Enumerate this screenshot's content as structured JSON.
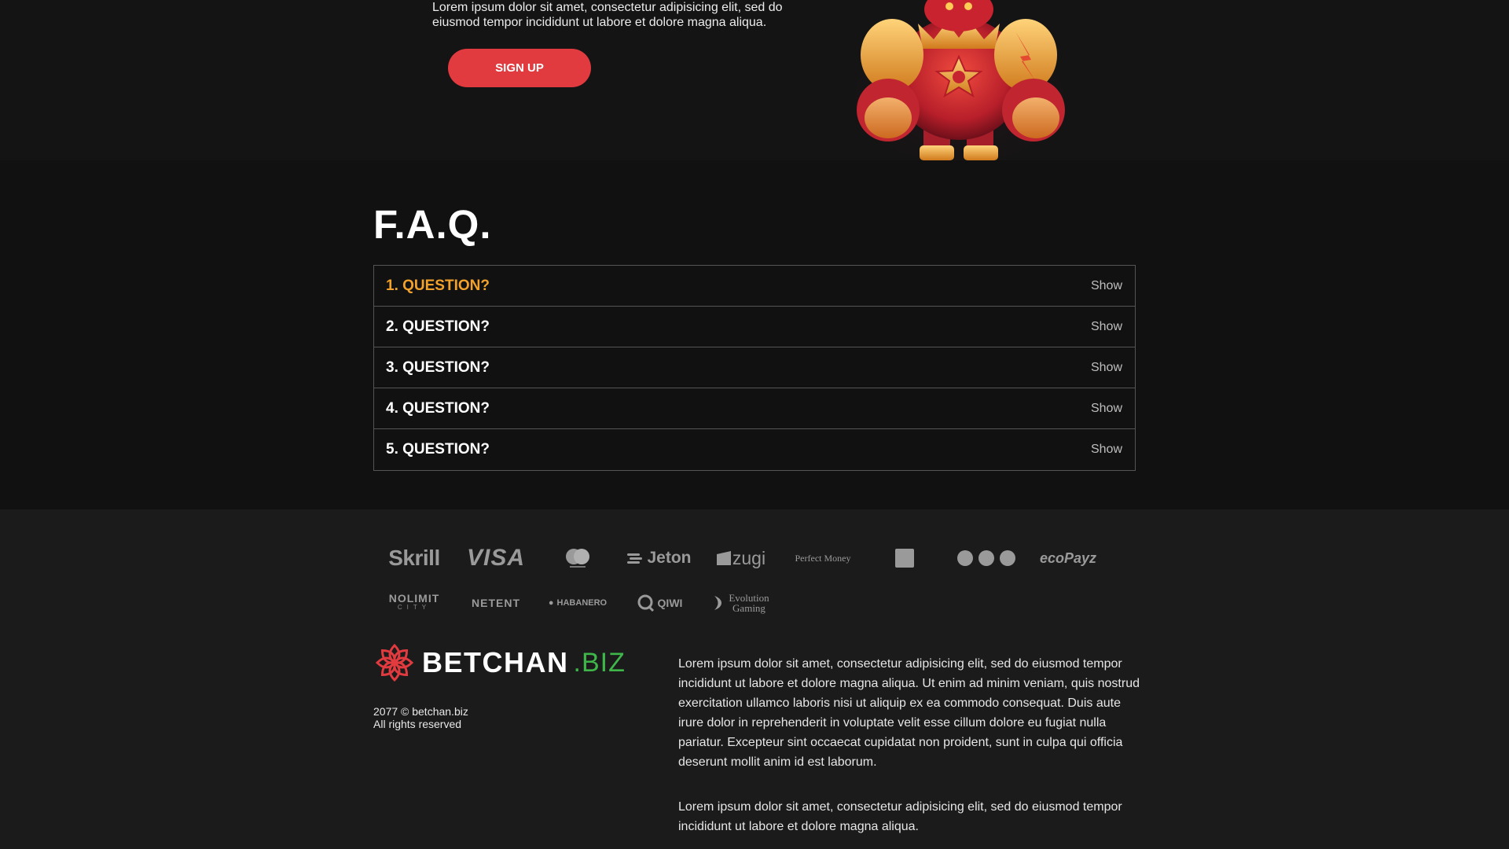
{
  "hero": {
    "text": "Lorem ipsum dolor sit amet, consectetur adipisicing elit, sed do eiusmod tempor incididunt ut labore et dolore magna aliqua.",
    "signup_label": "SIGN UP"
  },
  "faq": {
    "title": "F.A.Q.",
    "items": [
      {
        "question": "1. QUESTION?",
        "toggle": "Show",
        "active": true
      },
      {
        "question": "2. QUESTION?",
        "toggle": "Show",
        "active": false
      },
      {
        "question": "3. QUESTION?",
        "toggle": "Show",
        "active": false
      },
      {
        "question": "4. QUESTION?",
        "toggle": "Show",
        "active": false
      },
      {
        "question": "5. QUESTION?",
        "toggle": "Show",
        "active": false
      }
    ]
  },
  "payments": {
    "row1": [
      "Skrill",
      "VISA",
      "mastercard",
      "Jeton",
      "zugi",
      "Perfect Money",
      "square-logo",
      "three-dots-logo",
      "ecoPayz"
    ],
    "row1_text": {
      "skrill": "Skrill",
      "visa": "VISA",
      "jeton": "Jeton",
      "zugi": "zugi",
      "perfect_money": "Perfect Money",
      "ecopayz": "ecoPayz"
    },
    "row2_text": {
      "nolimit": "NOLIMIT",
      "nolimit_sub": "CITY",
      "netent": "NETENT",
      "habanero": "HABANERO",
      "qiwi": "QIWI",
      "evolution": "Evolution",
      "evolution_sub": "Gaming"
    }
  },
  "footer": {
    "brand_name": "BETCHAN",
    "brand_tld": ".BIZ",
    "copyright_line1": "2077 © betchan.biz",
    "copyright_line2": "All rights reserved",
    "paragraph1": "Lorem ipsum dolor sit amet, consectetur adipisicing elit, sed do eiusmod tempor incididunt ut labore et dolore magna aliqua. Ut enim ad minim veniam, quis nostrud exercitation ullamco laboris nisi ut aliquip ex ea commodo consequat. Duis aute irure dolor in reprehenderit in voluptate velit esse cillum dolore eu fugiat nulla pariatur. Excepteur sint occaecat cupidatat non proident, sunt in culpa qui officia deserunt mollit anim id est laborum.",
    "paragraph2": "Lorem ipsum dolor sit amet, consectetur adipisicing elit, sed do eiusmod tempor incididunt ut labore et dolore magna aliqua."
  },
  "colors": {
    "accent_red": "#e13a3f",
    "active_question": "#f2a22b",
    "brand_green": "#3fb64a"
  },
  "icons": [
    "robot-character-image",
    "mastercard-icon",
    "flower-logo-icon",
    "square-logo-icon",
    "three-dots-icon",
    "habanero-icon",
    "qiwi-icon",
    "evolution-icon"
  ]
}
